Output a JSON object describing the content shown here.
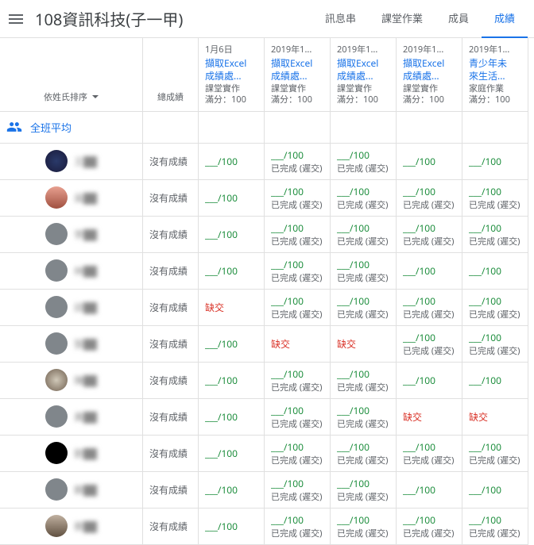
{
  "header": {
    "title": "108資訊科技(子一甲)",
    "tabs": [
      {
        "label": "訊息串",
        "active": false
      },
      {
        "label": "課堂作業",
        "active": false
      },
      {
        "label": "成員",
        "active": false
      },
      {
        "label": "成績",
        "active": true
      }
    ]
  },
  "sort": {
    "label": "依姓氏排序"
  },
  "total_label": "總成績",
  "class_avg_label": "全班平均",
  "assignments": [
    {
      "date": "1月6日",
      "title_l1": "擷取Excel",
      "title_l2": "成績處...",
      "type": "課堂實作",
      "max": "滿分：100"
    },
    {
      "date": "2019年1...",
      "title_l1": "擷取Excel",
      "title_l2": "成績處...",
      "type": "課堂實作",
      "max": "滿分：100"
    },
    {
      "date": "2019年1...",
      "title_l1": "擷取Excel",
      "title_l2": "成績處...",
      "type": "課堂實作",
      "max": "滿分：100"
    },
    {
      "date": "2019年1...",
      "title_l1": "擷取Excel",
      "title_l2": "成績處...",
      "type": "課堂實作",
      "max": "滿分：100"
    },
    {
      "date": "2019年1...",
      "title_l1": "青少年未",
      "title_l2": "來生活...",
      "type": "家庭作業",
      "max": "滿分：100"
    }
  ],
  "labels": {
    "no_grade": "沒有成績",
    "score_blank": "___/100",
    "late_done": "已完成 (遲交)",
    "missing": "缺交"
  },
  "students": [
    {
      "avatar": "img1",
      "name": "王██",
      "cells": [
        "score",
        "score_late",
        "score_late",
        "score",
        "score"
      ]
    },
    {
      "avatar": "img2",
      "name": "吳██",
      "cells": [
        "score",
        "score_late",
        "score_late",
        "score_late",
        "score_late"
      ]
    },
    {
      "avatar": "default",
      "name": "李██",
      "cells": [
        "score",
        "score_late",
        "score_late",
        "score_late",
        "score_late"
      ]
    },
    {
      "avatar": "default",
      "name": "林██",
      "cells": [
        "score",
        "score_late",
        "score_late",
        "score",
        "score"
      ]
    },
    {
      "avatar": "default",
      "name": "邱██",
      "cells": [
        "missing",
        "score_late",
        "score_late",
        "score_late",
        "score_late"
      ]
    },
    {
      "avatar": "default",
      "name": "張██",
      "cells": [
        "score",
        "missing",
        "missing",
        "score_late",
        "score_late"
      ]
    },
    {
      "avatar": "img3",
      "name": "陳██",
      "cells": [
        "score",
        "score_late",
        "score_late",
        "score",
        "score"
      ]
    },
    {
      "avatar": "default",
      "name": "黃██",
      "cells": [
        "score",
        "score_late",
        "score_late",
        "missing",
        "missing"
      ]
    },
    {
      "avatar": "black",
      "name": "劉██",
      "cells": [
        "score",
        "score_late",
        "score_late",
        "score_late",
        "score_late"
      ]
    },
    {
      "avatar": "default",
      "name": "鄭██",
      "cells": [
        "score",
        "score_late",
        "score_late",
        "score",
        "score"
      ]
    },
    {
      "avatar": "img4",
      "name": "蔡██",
      "cells": [
        "score",
        "score_late",
        "score_late",
        "score_late",
        "score_late"
      ]
    }
  ]
}
